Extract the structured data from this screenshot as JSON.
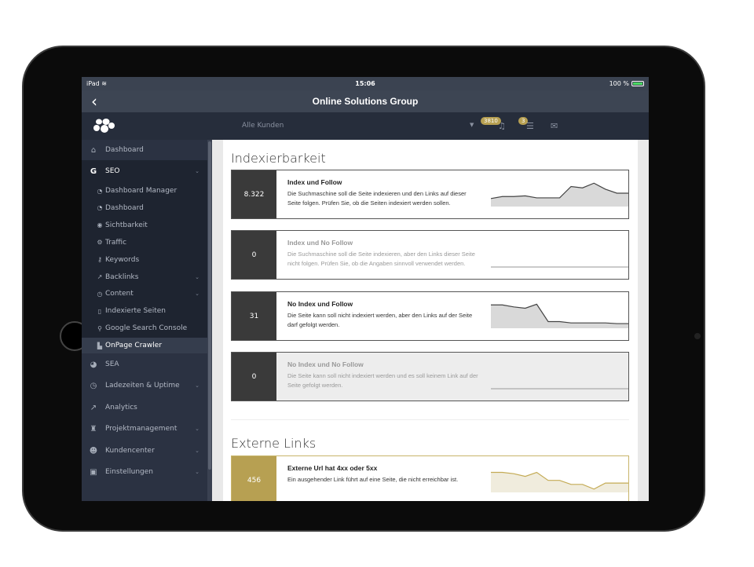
{
  "status": {
    "device": "iPad",
    "time": "15:06",
    "battery": "100 %"
  },
  "nav": {
    "back": "‹",
    "title": "Online Solutions Group"
  },
  "header": {
    "customer_select": "Alle Kunden",
    "notifications_count": "3810",
    "tasks_count": "3"
  },
  "sidebar": {
    "items": [
      {
        "label": "Dashboard",
        "icon": "home-icon",
        "glyph": "⌂"
      },
      {
        "label": "SEO",
        "icon": "google-icon",
        "glyph": "G",
        "expanded": true
      },
      {
        "label": "SEA",
        "icon": "pie-chart-icon",
        "glyph": "◕"
      },
      {
        "label": "Ladezeiten & Uptime",
        "icon": "clock-icon",
        "glyph": "◷"
      },
      {
        "label": "Analytics",
        "icon": "line-chart-icon",
        "glyph": "↗"
      },
      {
        "label": "Projektmanagement",
        "icon": "binoculars-icon",
        "glyph": "♜"
      },
      {
        "label": "Kundencenter",
        "icon": "users-icon",
        "glyph": "☻"
      },
      {
        "label": "Einstellungen",
        "icon": "lock-icon",
        "glyph": "▣"
      }
    ],
    "seo_sub": [
      {
        "label": "Dashboard Manager",
        "icon": "dashboard-icon",
        "glyph": "◔"
      },
      {
        "label": "Dashboard",
        "icon": "dashboard-icon",
        "glyph": "◔"
      },
      {
        "label": "Sichtbarkeit",
        "icon": "eye-icon",
        "glyph": "◉"
      },
      {
        "label": "Traffic",
        "icon": "cogs-icon",
        "glyph": "⚙"
      },
      {
        "label": "Keywords",
        "icon": "key-icon",
        "glyph": "⚷"
      },
      {
        "label": "Backlinks",
        "icon": "external-link-icon",
        "glyph": "↗"
      },
      {
        "label": "Content",
        "icon": "clock-icon",
        "glyph": "◷"
      },
      {
        "label": "Indexierte Seiten",
        "icon": "file-icon",
        "glyph": "▯"
      },
      {
        "label": "Google Search Console",
        "icon": "search-icon",
        "glyph": "⚲"
      },
      {
        "label": "OnPage Crawler",
        "icon": "area-chart-icon",
        "glyph": "▙",
        "active": true
      }
    ]
  },
  "sections": {
    "indexierbarkeit": {
      "title": "Indexierbarkeit",
      "cards": [
        {
          "value": "8.322",
          "title": "Index und Follow",
          "desc": "Die Suchmaschine soll die Seite indexieren und den Links auf dieser Seite folgen. Prüfen Sie, ob die Seiten indexiert werden sollen.",
          "trend": [
            12,
            15,
            15,
            16,
            13,
            13,
            13,
            30,
            28,
            35,
            26,
            20,
            20
          ]
        },
        {
          "value": "0",
          "title": "Index und No Follow",
          "desc": "Die Suchmaschine soll die Seite indexieren, aber den Links dieser Seite nicht folgen. Prüfen Sie, ob die Angaben sinnvoll verwendet werden.",
          "trend": [
            0,
            0,
            0,
            0,
            0,
            0,
            0,
            0,
            0,
            0,
            0,
            0,
            0
          ]
        },
        {
          "value": "31",
          "title": "No Index und Follow",
          "desc": "Die Seite kann soll nicht indexiert werden, aber den Links auf der Seite darf gefolgt werden.",
          "trend": [
            35,
            35,
            32,
            30,
            36,
            10,
            10,
            8,
            8,
            8,
            8,
            7,
            7
          ]
        },
        {
          "value": "0",
          "title": "No Index und No Follow",
          "desc": "Die Seite kann soll nicht indexiert werden und es soll keinem Link auf der Seite gefolgt werden.",
          "trend": [
            0,
            0,
            0,
            0,
            0,
            0,
            0,
            0,
            0,
            0,
            0,
            0,
            0
          ]
        }
      ]
    },
    "externe_links": {
      "title": "Externe Links",
      "cards": [
        {
          "value": "456",
          "title": "Externe Url hat 4xx oder 5xx",
          "desc": "Ein ausgehender Link führt auf eine Seite, die nicht erreichbar ist.",
          "trend": [
            30,
            30,
            28,
            24,
            30,
            18,
            18,
            12,
            12,
            5,
            14,
            14,
            14
          ]
        }
      ]
    }
  },
  "colors": {
    "accent": "#b7a052",
    "sidebar": "#2b3242",
    "header": "#262d3b",
    "number_box": "#3a3a3a"
  }
}
